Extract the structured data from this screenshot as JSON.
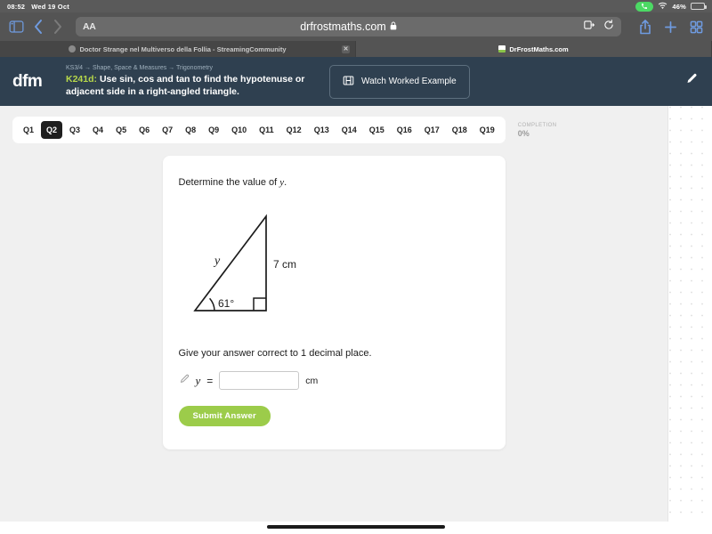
{
  "status_bar": {
    "time": "08:52",
    "date": "Wed 19 Oct",
    "call_icon": "phone-icon",
    "wifi_icon": "wifi-icon",
    "battery_percent": "46%",
    "battery_level": 46
  },
  "browser": {
    "sidebar_icon": "sidebar-icon",
    "back_icon": "chevron-left-icon",
    "forward_icon": "chevron-right-icon",
    "reader_label": "AA",
    "url": "drfrostmaths.com",
    "lock_icon": "lock-icon",
    "extensions_icon": "extensions-icon",
    "reload_icon": "reload-icon",
    "share_icon": "share-icon",
    "new_tab_icon": "plus-icon",
    "tabs_overview_icon": "tab-grid-icon",
    "tabs": [
      {
        "title": "Doctor Strange nel Multiverso della Follia - StreamingCommunity",
        "active": false,
        "close_icon": "close-icon"
      },
      {
        "title": "DrFrostMaths.com",
        "active": true
      }
    ]
  },
  "app_header": {
    "logo": "dfm",
    "breadcrumb": "KS3/4 → Shape, Space & Measures → Trigonometry",
    "topic_code": "K241d:",
    "topic_title": "Use sin, cos and tan to find the hypotenuse or adjacent side in a right-angled triangle.",
    "watch_button_label": "Watch Worked Example",
    "watch_button_icon": "video-icon",
    "pen_icon": "pen-icon",
    "accent_color": "#b7d84a",
    "background_color": "#2f4050"
  },
  "question_nav": {
    "questions": [
      "Q1",
      "Q2",
      "Q3",
      "Q4",
      "Q5",
      "Q6",
      "Q7",
      "Q8",
      "Q9",
      "Q10",
      "Q11",
      "Q12",
      "Q13",
      "Q14",
      "Q15",
      "Q16",
      "Q17",
      "Q18",
      "Q19"
    ],
    "active": "Q2",
    "completion_label": "COMPLETION",
    "completion_value": "0%"
  },
  "question": {
    "prompt_prefix": "Determine the value of",
    "prompt_variable": "y",
    "prompt_suffix": ".",
    "instruction": "Give your answer correct to 1 decimal place.",
    "answer_variable": "y",
    "answer_equals": "=",
    "answer_value": "",
    "answer_placeholder": "",
    "answer_unit": "cm",
    "answer_pencil_icon": "pencil-icon",
    "submit_label": "Submit Answer",
    "submit_color": "#9ccc4a"
  },
  "figure": {
    "type": "right-angled-triangle",
    "hypotenuse_label": "y",
    "opposite_label": "7 cm",
    "angle_label": "61°",
    "right_angle_marker": true
  },
  "scratchpad": {
    "name": "dot-grid-scratchpad"
  }
}
